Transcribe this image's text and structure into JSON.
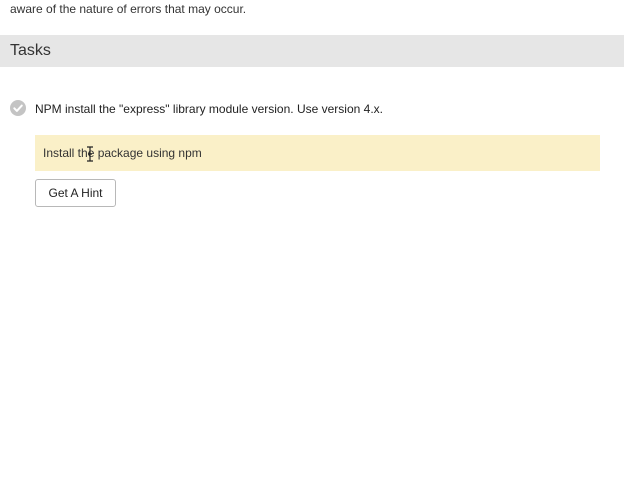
{
  "intro": {
    "text": "aware of the nature of errors that may occur."
  },
  "tasks_section": {
    "title": "Tasks",
    "items": [
      {
        "text": "NPM install the \"express\" library module version. Use version 4.x.",
        "status_icon": "check-circle-icon",
        "completed": true,
        "hint": "Install the package using npm",
        "hint_button_label": "Get A Hint"
      }
    ]
  },
  "colors": {
    "header_bg": "#e6e6e6",
    "hint_bg": "#faf0c8",
    "check_icon": "#c4c4c4"
  }
}
